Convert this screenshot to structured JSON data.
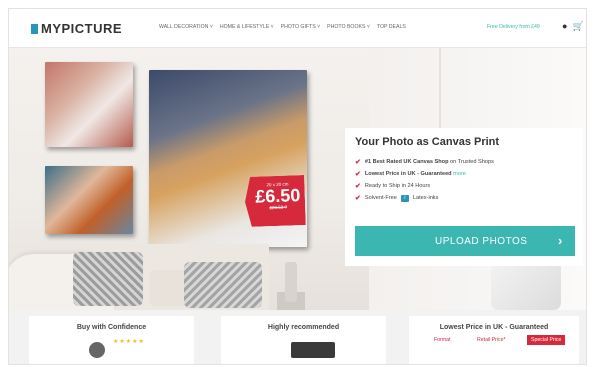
{
  "header": {
    "logo": "MYPICTURE",
    "nav": [
      "WALL DECORATION ˅",
      "HOME & LIFESTYLE ˅",
      "PHOTO GIFTS ˅",
      "PHOTO BOOKS ˅",
      "TOP DEALS"
    ],
    "delivery": "Free Delivery from £49",
    "icons": [
      "user-icon",
      "cart-icon"
    ]
  },
  "hero": {
    "badge": {
      "top": "20 x 20 cm",
      "price": "£6.50",
      "old": "£20.50 ?"
    }
  },
  "promo": {
    "title": "Your Photo as Canvas Print",
    "features": [
      {
        "bold": "#1 Best Rated UK Canvas Shop",
        "rest": " on Trusted Shops"
      },
      {
        "bold": "Lowest Price in UK - Guaranteed",
        "rest": "",
        "more": "more"
      },
      {
        "bold": "",
        "rest": "Ready to Ship in 24 Hours"
      },
      {
        "bold": "",
        "rest": "Solvent-Free",
        "after": "Latex-inks"
      }
    ],
    "button": "UPLOAD PHOTOS",
    "button_arrow": "›"
  },
  "bottom": {
    "card1": {
      "title": "Buy with Confidence",
      "stars": "★★★★★"
    },
    "card2": {
      "title": "Highly recommended"
    },
    "card3": {
      "title": "Lowest Price in UK - Guaranteed",
      "cols": [
        "Format",
        "Retail Price*",
        "Special Price"
      ]
    }
  },
  "colors": {
    "accent": "#3cb6b0",
    "red": "#d62a3c",
    "logo_blue": "#2a95b8"
  }
}
